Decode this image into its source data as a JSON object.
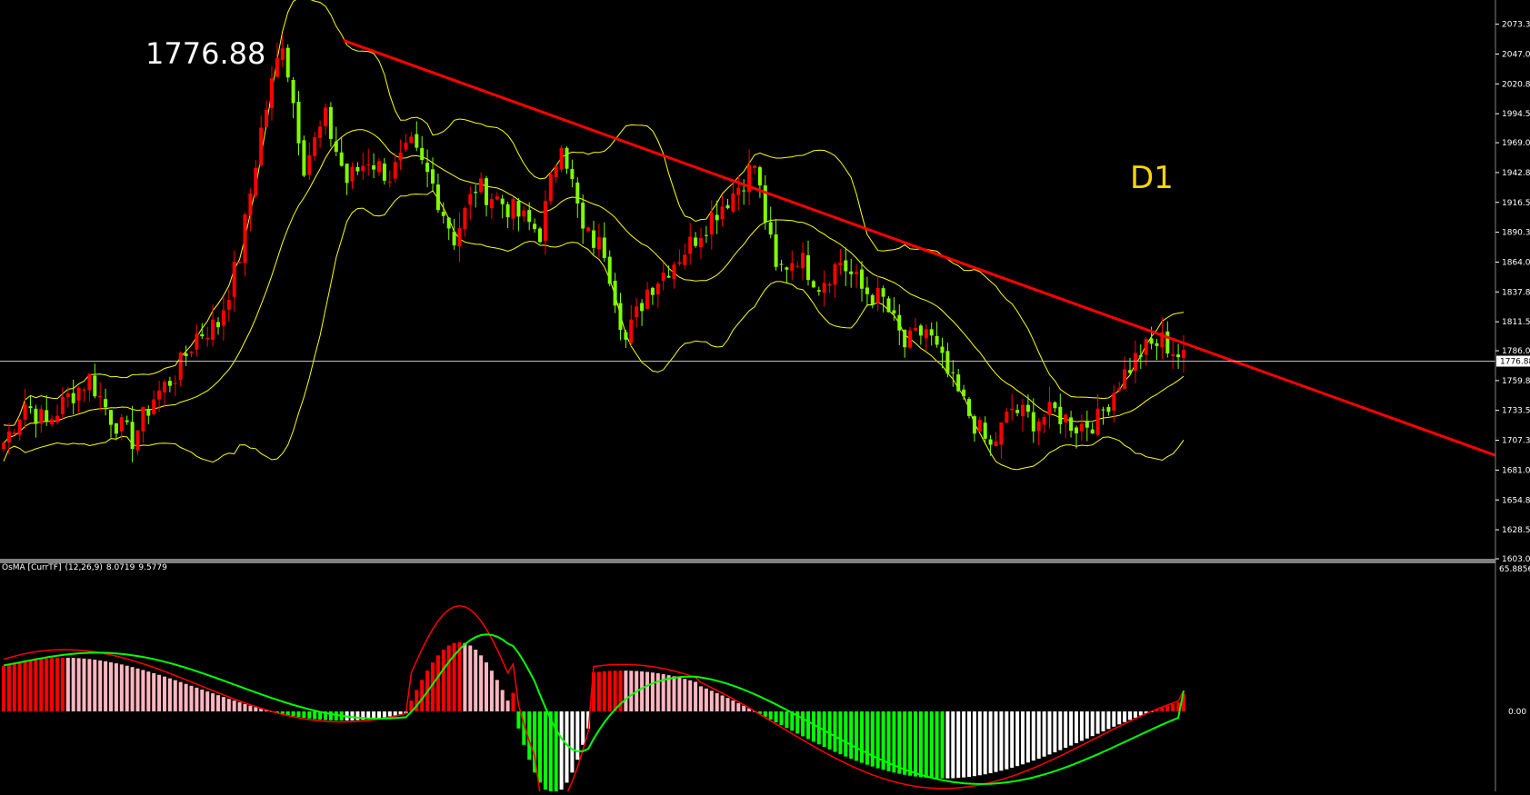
{
  "chart": {
    "price_label": "1776.88",
    "timeframe_label": "D1",
    "current_price_tag": "1776.88",
    "current_price": 1776.88,
    "colors": {
      "background": "#000000",
      "bull_candle": "#ff0000",
      "bear_candle": "#7fff00",
      "bollinger": "#ffff00",
      "trendline": "#ff0000",
      "price_line": "#c0c0c0",
      "separator": "#808080",
      "axis_text": "#ffffff",
      "osma_pos_up": "#ff0000",
      "osma_pos_down": "#ffb6c1",
      "osma_neg_down": "#00ff00",
      "osma_neg_up": "#ffffff",
      "macd_line": "#ff0000",
      "signal_line": "#00ff00"
    }
  },
  "indicator": {
    "name": "OsMA [CurrTF]",
    "params": "(12,26,9)",
    "value1": "8.0719",
    "value2": "9.5779",
    "axis_top_label": "65.8856",
    "axis_zero_label": "0.00",
    "axis_top": 65.8856
  },
  "chart_data": {
    "type": "candlestick",
    "timeframe": "D1",
    "ylim": [
      1603.05,
      2085
    ],
    "y_ticks": [
      "2073.30",
      "2047.05",
      "2020.80",
      "1994.55",
      "1969.05",
      "1942.80",
      "1916.55",
      "1890.30",
      "1864.05",
      "1837.80",
      "1811.55",
      "1786.05",
      "1759.80",
      "1733.55",
      "1707.30",
      "1681.05",
      "1654.80",
      "1628.55",
      "1603.05"
    ],
    "close_anchors": [
      1705,
      1740,
      1722,
      1745,
      1762,
      1728,
      1708,
      1745,
      1765,
      1800,
      1810,
      1870,
      1980,
      2060,
      1950,
      1990,
      1935,
      1955,
      1940,
      1965,
      1932,
      1885,
      1930,
      1920,
      1905,
      1890,
      1975,
      1890,
      1875,
      1795,
      1840,
      1860,
      1880,
      1905,
      1925,
      1950,
      1855,
      1870,
      1845,
      1865,
      1840,
      1830,
      1790,
      1805,
      1765,
      1730,
      1700,
      1735,
      1725,
      1732,
      1720,
      1725,
      1760,
      1785,
      1795,
      1778
    ],
    "candle_count": 221,
    "bollinger_period": 20,
    "bollinger_dev": 2,
    "trendline": {
      "start_price": 2059,
      "end_price": 1694,
      "span_candles": 261
    },
    "osma": {
      "zero": 0,
      "histogram_peak": 32,
      "histogram_trough": -38,
      "last_value": 8.0719,
      "last_signal": 9.5779
    }
  }
}
